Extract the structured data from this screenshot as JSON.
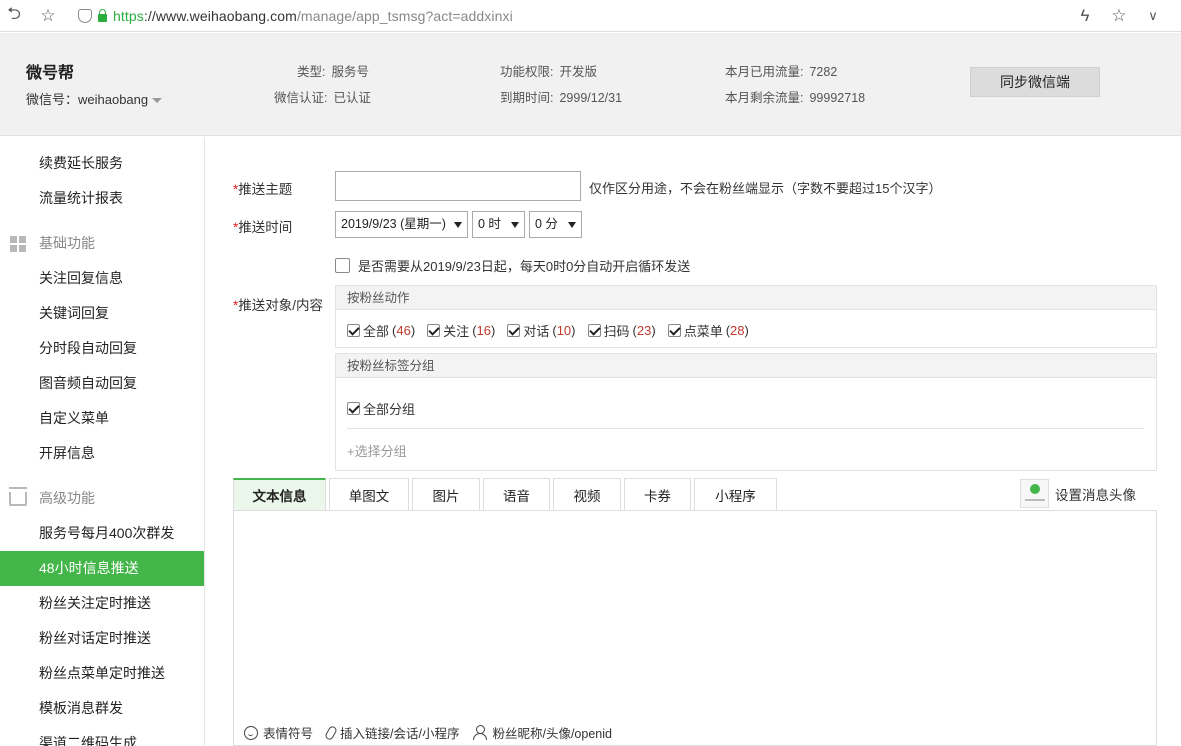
{
  "browser": {
    "url_scheme": "https",
    "url_host": "://www.weihaobang.com",
    "url_path": "/manage/app_tsmsg?act=addxinxi"
  },
  "header": {
    "brand": "微号帮",
    "wx_id": "微信号：weihaobang",
    "type_label": "类型:",
    "type_value": "服务号",
    "verify_label": "微信认证:",
    "verify_value": "已认证",
    "perm_label": "功能权限:",
    "perm_value": "开发版",
    "expire_label": "到期时间:",
    "expire_value": "2999/12/31",
    "used_label": "本月已用流量:",
    "used_value": "7282",
    "remain_label": "本月剩余流量:",
    "remain_value": "99992718",
    "sync_button": "同步微信端"
  },
  "sidebar": {
    "items_top": [
      "续费延长服务",
      "流量统计报表"
    ],
    "group_basic": "基础功能",
    "items_basic": [
      "关注回复信息",
      "关键词回复",
      "分时段自动回复",
      "图音频自动回复",
      "自定义菜单",
      "开屏信息"
    ],
    "group_adv": "高级功能",
    "items_adv": [
      "服务号每月400次群发",
      "48小时信息推送",
      "粉丝关注定时推送",
      "粉丝对话定时推送",
      "粉丝点菜单定时推送",
      "模板消息群发",
      "渠道二维码生成"
    ]
  },
  "form": {
    "req_mark": "*",
    "subject_label": "推送主题",
    "subject_value": "",
    "subject_hint": "仅作区分用途，不会在粉丝端显示（字数不要超过15个汉字）",
    "time_label": "推送时间",
    "date_value": "2019/9/23 (星期一)",
    "hour_value": "0 时",
    "minute_value": "0 分",
    "loop_text": "是否需要从2019/9/23日起，每天0时0分自动开启循环发送",
    "target_label": "推送对象/内容",
    "action_panel_title": "按粉丝动作",
    "actions": [
      {
        "label": "全部",
        "count": "46"
      },
      {
        "label": "关注",
        "count": "16"
      },
      {
        "label": "对话",
        "count": "10"
      },
      {
        "label": "扫码",
        "count": "23"
      },
      {
        "label": "点菜单",
        "count": "28"
      }
    ],
    "tag_panel_title": "按粉丝标签分组",
    "all_groups": "全部分组",
    "select_group": "+选择分组"
  },
  "tabs": [
    "文本信息",
    "单图文",
    "图片",
    "语音",
    "视频",
    "卡券",
    "小程序"
  ],
  "avatar_setting": "设置消息头像",
  "toolbar": {
    "emoji": "表情符号",
    "link": "插入链接/会话/小程序",
    "fan": "粉丝昵称/头像/openid"
  }
}
